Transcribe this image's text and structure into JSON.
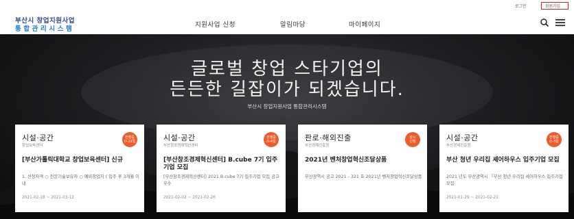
{
  "top": {
    "login": "로그인",
    "signup": "회원가입"
  },
  "header": {
    "logo_line1": "부산시 창업지원사업",
    "logo_line2": "통합관리시스템",
    "nav": [
      "지원사업 신청",
      "알림마당",
      "마이페이지"
    ],
    "icons": [
      "search-icon",
      "menu-icon"
    ]
  },
  "hero": {
    "title_line1": "글로벌 창업 스타기업의",
    "title_line2": "든든한 길잡이가 되겠습니다.",
    "subtitle": "부산시 창업지원사업 통합관리시스템"
  },
  "cards": [
    {
      "category": "시설·공간",
      "org": "창업보육센터",
      "badge_line1": "진행중",
      "badge_line2": "D-22일",
      "title": "[부산가톨릭대학교 창업보육센터] 신규",
      "desc": "1. 신청자격 ○ 전문기술보유자 ○ 예비창업자 ( 입주 후 3개월 이내",
      "date": "2021-02-18 ~ 2021-03-12"
    },
    {
      "category": "시설·공간",
      "org": "부산창조경제혁신센터",
      "badge_line1": "진행중",
      "badge_line2": "D-8일",
      "title": "[부산창조경제혁신센터] B.cube 7기 입주기업 모집",
      "desc": "[부산창조경제혁신센터] 2021 B.cube 7기 입주기업 모집 공고 우수",
      "date": "2021-02-02 ~ 2021-02-26"
    },
    {
      "category": "판로·해외진출",
      "org": "부산경제진흥원",
      "badge_line1": "상시",
      "badge_line2": "신청",
      "title": "2021년 벤처창업혁신조달상품",
      "desc": "부산광역시 공고 2021 - 321 호 2021년 벤처창업혁신조달상품",
      "date": ""
    },
    {
      "category": "시설·공간",
      "org": "부산경제진흥원",
      "badge_line1": "진행중",
      "badge_line2": "D-3일",
      "title": "부산 청년 우리집 셰어하우스 입주기업 모집",
      "desc": "2021 년도 부산광역시 「부산 청년 우리집 셰어하우스 입주기업 모집",
      "date": "2021-01-29 ~ 2021-02-21"
    }
  ],
  "colors": {
    "badge": "#f05a28",
    "logo_dark": "#2f4a8c",
    "logo_blue": "#1f7fc4",
    "signup_border": "#e02020"
  }
}
